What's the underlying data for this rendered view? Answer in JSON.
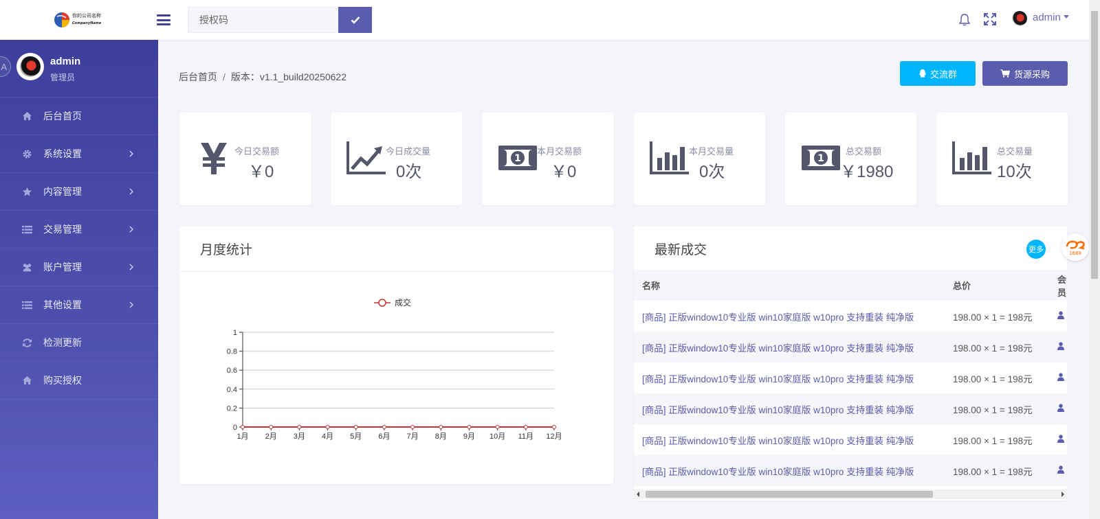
{
  "header": {
    "logo_name": "你的公司名称",
    "logo_sub": "CompanyName",
    "search": {
      "placeholder": "授权码",
      "value": ""
    },
    "user": "admin"
  },
  "sidebar": {
    "user": {
      "name": "admin",
      "role": "管理员",
      "badge": "A"
    },
    "items": [
      {
        "label": "后台首页",
        "icon": "home-icon",
        "has_children": false
      },
      {
        "label": "系统设置",
        "icon": "gear-icon",
        "has_children": true
      },
      {
        "label": "内容管理",
        "icon": "star-icon",
        "has_children": true
      },
      {
        "label": "交易管理",
        "icon": "list-icon",
        "has_children": true
      },
      {
        "label": "账户管理",
        "icon": "users-icon",
        "has_children": true
      },
      {
        "label": "其他设置",
        "icon": "list-icon",
        "has_children": true
      },
      {
        "label": "检测更新",
        "icon": "refresh-icon",
        "has_children": false
      },
      {
        "label": "购买授权",
        "icon": "home-icon",
        "has_children": false
      }
    ]
  },
  "main": {
    "breadcrumb": {
      "home": "后台首页",
      "sep": "/",
      "version": "版本：v1.1_build20250622"
    },
    "buttons": {
      "group": "交流群",
      "purchase": "货源采购"
    },
    "stats": [
      {
        "label": "今日交易额",
        "value": "￥0",
        "icon": "yen-icon"
      },
      {
        "label": "今日成交量",
        "value": "0次",
        "icon": "trend-chart-icon"
      },
      {
        "label": "本月交易额",
        "value": "￥0",
        "icon": "money-bill-icon"
      },
      {
        "label": "本月交易量",
        "value": "0次",
        "icon": "bar-chart-icon"
      },
      {
        "label": "总交易额",
        "value": "￥1980",
        "icon": "money-bill-icon"
      },
      {
        "label": "总交易量",
        "value": "10次",
        "icon": "bar-chart-icon"
      }
    ],
    "monthly": {
      "title": "月度统计"
    },
    "latest": {
      "title": "最新成交",
      "more": "更多",
      "columns": [
        "名称",
        "总价",
        "会员"
      ],
      "rows": [
        {
          "name": "[商品] 正版window10专业版 win10家庭版 w10pro 支持重装 纯净版",
          "price": "198.00 × 1 = 198元"
        },
        {
          "name": "[商品] 正版window10专业版 win10家庭版 w10pro 支持重装 纯净版",
          "price": "198.00 × 1 = 198元"
        },
        {
          "name": "[商品] 正版window10专业版 win10家庭版 w10pro 支持重装 纯净版",
          "price": "198.00 × 1 = 198元"
        },
        {
          "name": "[商品] 正版window10专业版 win10家庭版 w10pro 支持重装 纯净版",
          "price": "198.00 × 1 = 198元"
        },
        {
          "name": "[商品] 正版window10专业版 win10家庭版 w10pro 支持重装 纯净版",
          "price": "198.00 × 1 = 198元"
        },
        {
          "name": "[商品] 正版window10专业版 win10家庭版 w10pro 支持重装 纯净版",
          "price": "198.00 × 1 = 198元"
        }
      ]
    }
  },
  "chart_data": {
    "type": "line",
    "title": "",
    "categories": [
      "1月",
      "2月",
      "3月",
      "4月",
      "5月",
      "6月",
      "7月",
      "8月",
      "9月",
      "10月",
      "11月",
      "12月"
    ],
    "series": [
      {
        "name": "成交",
        "values": [
          0,
          0,
          0,
          0,
          0,
          0,
          0,
          0,
          0,
          0,
          0,
          0
        ]
      }
    ],
    "yticks": [
      "0",
      "0.2",
      "0.4",
      "0.6",
      "0.8",
      "1"
    ],
    "ylim": [
      0,
      1
    ],
    "grid": true,
    "legend": "top",
    "colors": {
      "line": "#c23531"
    }
  },
  "colors": {
    "accent": "#5a5cad",
    "info": "#00b5ff",
    "sidebar": "#4547a4"
  }
}
